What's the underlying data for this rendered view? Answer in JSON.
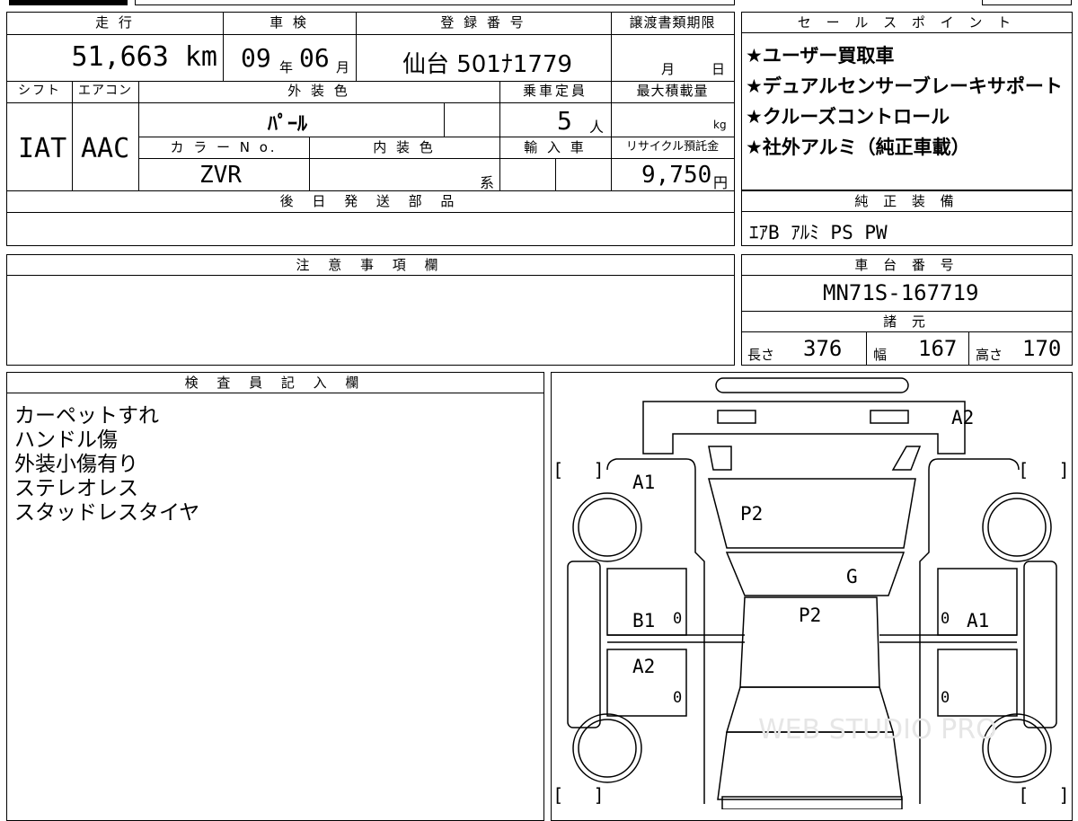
{
  "header": {
    "mileage_label": "走 行",
    "mileage_value": "51,663 km",
    "inspection_label": "車 検",
    "inspection_year": "09",
    "year_unit": "年",
    "inspection_month": "06",
    "month_unit": "月",
    "registration_label": "登 録 番 号",
    "registration_value": "仙台 501ﾅ1779",
    "transfer_label": "譲渡書類期限",
    "transfer_month_unit": "月",
    "transfer_day_unit": "日"
  },
  "row2": {
    "shift_label": "シフト",
    "shift_value": "IAT",
    "aircon_label": "エアコン",
    "aircon_value": "AAC",
    "exterior_color_label": "外 装 色",
    "exterior_color_value": "ﾊﾟｰﾙ",
    "capacity_label": "乗車定員",
    "capacity_value": "5",
    "capacity_unit": "人",
    "max_load_label": "最大積載量",
    "max_load_unit": "kg",
    "color_no_label": "カ ラ ー N o.",
    "color_no_value": "ZVR",
    "interior_color_label": "内 装 色",
    "interior_suffix": "系",
    "import_label": "輸 入 車",
    "recycle_label": "リサイクル預託金",
    "recycle_value": "9,750",
    "recycle_unit": "円"
  },
  "later_parts": {
    "label": "後 日 発 送 部 品",
    "value": ""
  },
  "sales_points": {
    "label": "セ ー ル ス ポ イ ン ト",
    "items": [
      "★ユーザー買取車",
      "★デュアルセンサーブレーキサポート",
      "★クルーズコントロール",
      "★社外アルミ（純正車載）"
    ]
  },
  "genuine_equipment": {
    "label": "純 正 装 備",
    "value": "ｴｱB ｱﾙﾐ PS PW"
  },
  "notes": {
    "label": "注 意 事 項 欄",
    "value": ""
  },
  "chassis": {
    "label": "車 台 番 号",
    "value": "MN71S-167719"
  },
  "specs": {
    "label": "諸 元",
    "length_label": "長さ",
    "length_value": "376",
    "width_label": "幅",
    "width_value": "167",
    "height_label": "高さ",
    "height_value": "170"
  },
  "inspector": {
    "label": "検 査 員 記 入 欄",
    "lines": [
      "カーペットすれ",
      "ハンドル傷",
      "外装小傷有り",
      "ステレオレス",
      "スタッドレスタイヤ"
    ]
  },
  "diagram": {
    "marks": {
      "rear_right": "A2",
      "front_left_fender": "A1",
      "hood": "P2",
      "windshield": "G",
      "roof": "P2",
      "left_front_door": "B1",
      "left_rear_door": "A2",
      "right_front_door": "A1",
      "zero": "0",
      "bracket_open": "[",
      "bracket_close": "]"
    },
    "watermark": "WEB STUDIO PRO"
  }
}
